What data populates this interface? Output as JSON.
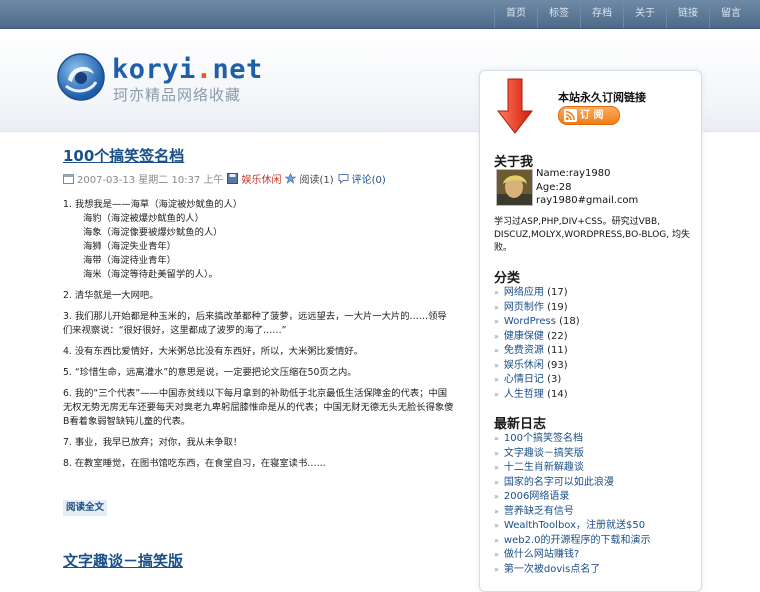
{
  "nav": {
    "items": [
      "首页",
      "标签",
      "存档",
      "关于",
      "链接",
      "留言"
    ]
  },
  "site": {
    "name_a": "koryi",
    "name_dot": ".",
    "name_b": "net",
    "tagline": "珂亦精品网络收藏"
  },
  "post": {
    "title": "100个搞笑签名档",
    "date": "2007-03-13 星期二 10:37 上午",
    "category": "娱乐休闲",
    "reads": "阅读(1)",
    "comments": "评论(0)",
    "items": [
      {
        "text": "1. 我想我是——海草（海淀被炒鱿鱼的人）",
        "sub": [
          "海豹（海淀被爆炒鱿鱼的人）",
          "海象（海淀像要被爆炒鱿鱼的人）",
          "海狮（海淀失业青年）",
          "海带（海淀待业青年）",
          "海米（海淀等待赴美留学的人）。"
        ]
      },
      {
        "text": "2. 清华就是一大网吧。"
      },
      {
        "text": "3. 我们那儿开始都是种玉米的，后来搞改革都种了菠萝，远远望去，一大片一大片的……领导们来视察说：“很好很好，这里都成了波罗的海了……”"
      },
      {
        "text": "4. 没有东西比爱情好，大米粥总比没有东西好，所以，大米粥比爱情好。"
      },
      {
        "text": "5. “珍惜生命，远离灌水”的意思是说，一定要把论文压缩在50页之内。"
      },
      {
        "text": "6. 我的“三个代表”——中国赤贫线以下每月拿到的补助低于北京最低生活保障金的代表；中国无权无势无房无车还要每天对臭老九卑躬屈膝惟命是从的代表；中国无财无德无头无脸长得象傻B看着象弱智缺钝儿童的代表。"
      },
      {
        "text": "7. 事业，我早已放弃；对你，我从未争取！"
      },
      {
        "text": "8. 在教室睡觉，在图书馆吃东西，在食堂自习，在寝室读书……"
      }
    ],
    "read_more": "阅读全文"
  },
  "post2": {
    "title": "文字趣谈－搞笑版"
  },
  "sidebar": {
    "subscribe_title": "本站永久订阅链接",
    "rss_label": "订 阅",
    "about_heading": "关于我",
    "profile": [
      "Name:ray1980",
      "Age:28",
      "ray1980#gmail.com"
    ],
    "bio": "学习过ASP,PHP,DIV+CSS。研究过VBB, DISCUZ,MOLYX,WORDPRESS,BO-BLOG, 均失败。",
    "categories_heading": "分类",
    "categories": [
      {
        "name": "网络应用",
        "count": "(17)"
      },
      {
        "name": "网页制作",
        "count": "(19)"
      },
      {
        "name": "WordPress",
        "count": "(18)"
      },
      {
        "name": "健康保健",
        "count": "(22)"
      },
      {
        "name": "免费资源",
        "count": "(11)"
      },
      {
        "name": "娱乐休闲",
        "count": "(93)"
      },
      {
        "name": "心情日记",
        "count": "(3)"
      },
      {
        "name": "人生哲理",
        "count": "(14)"
      }
    ],
    "recent_heading": "最新日志",
    "recent": [
      "100个搞笑签名档",
      "文字趣谈－搞笑版",
      "十二生肖新解趣谈",
      "国家的名字可以如此浪漫",
      "2006网络语录",
      "营养缺乏有信号",
      "WealthToolbox，注册就送$50",
      "web2.0的开源程序的下载和演示",
      "做什么网站赚钱?",
      "第一次被dovis点名了"
    ]
  },
  "colors": {
    "link": "#1b4f87",
    "accent": "#e85a1c",
    "nav_bg": "#5a7694"
  }
}
